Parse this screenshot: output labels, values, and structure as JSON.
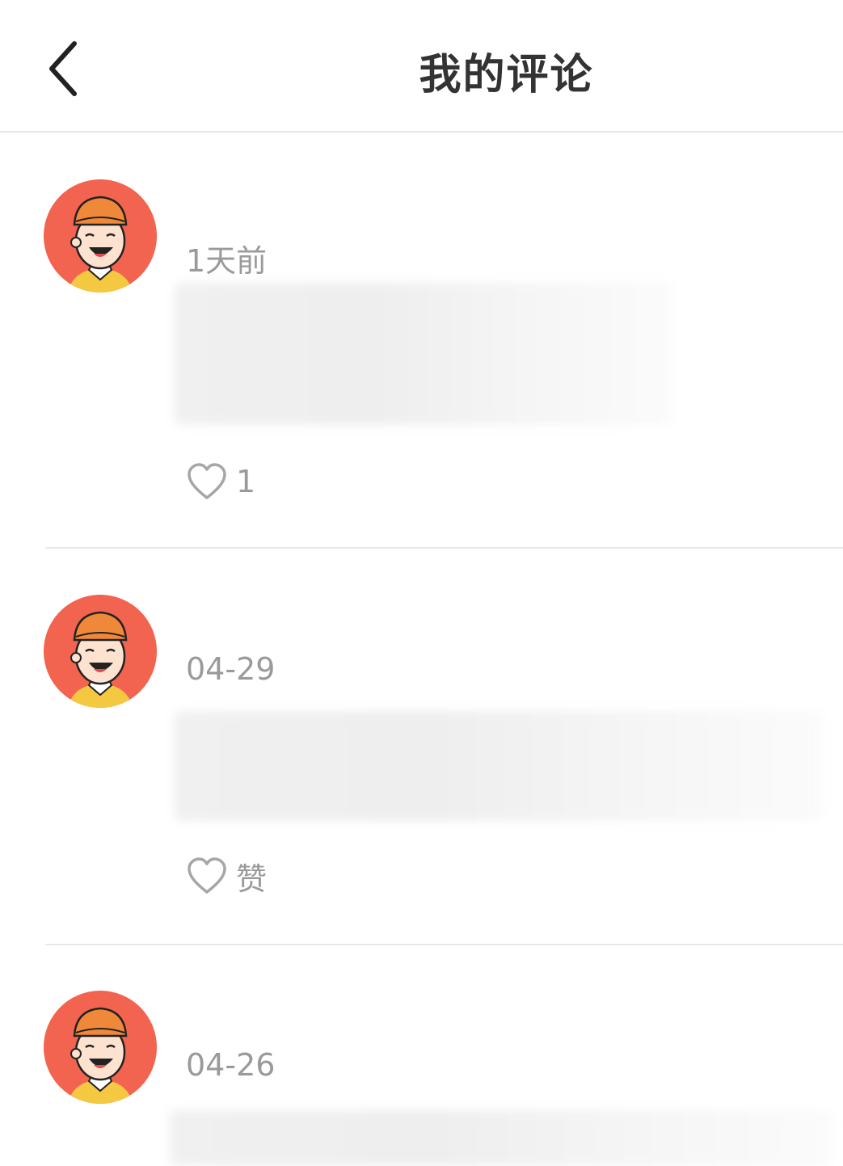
{
  "header": {
    "title": "我的评论"
  },
  "comments": [
    {
      "time": "1天前",
      "like_label": "1"
    },
    {
      "time": "04-29",
      "like_label": "赞"
    },
    {
      "time": "04-26"
    }
  ]
}
